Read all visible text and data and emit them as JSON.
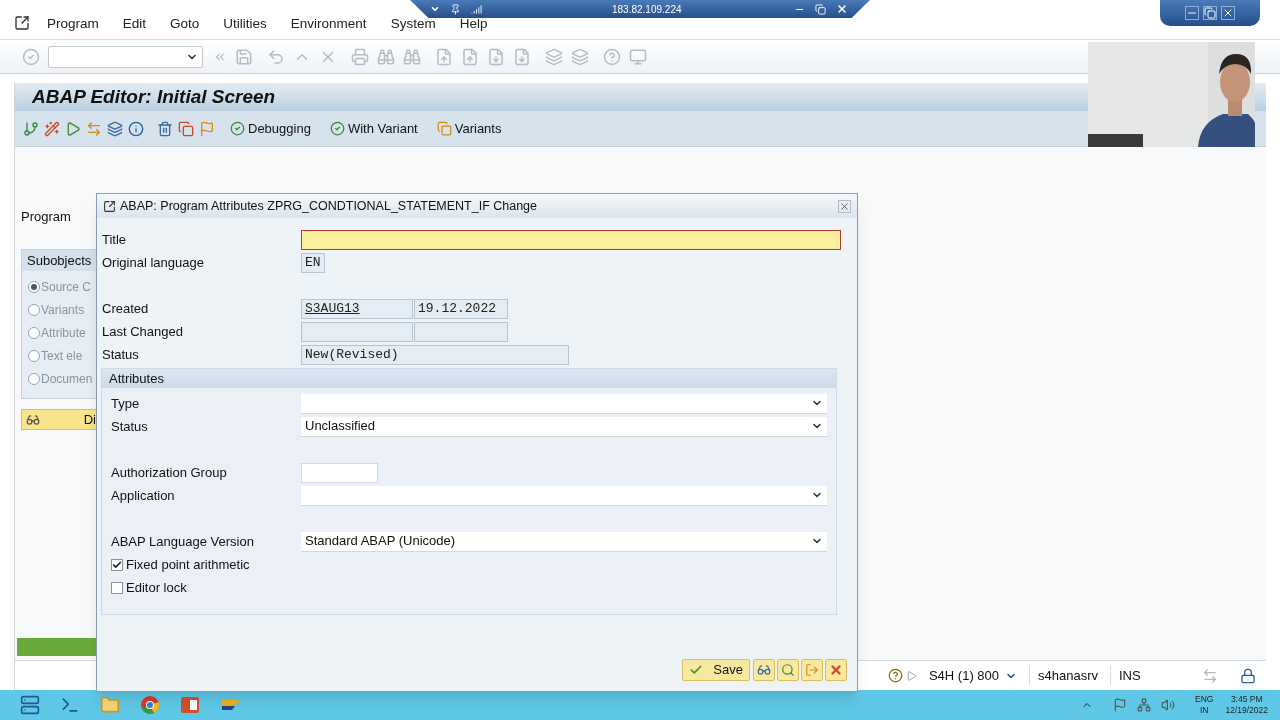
{
  "remote_bar": {
    "address": "183.82.109.224"
  },
  "menu_bar": {
    "items": [
      "Program",
      "Edit",
      "Goto",
      "Utilities",
      "Environment",
      "System",
      "Help"
    ]
  },
  "screen_title": "ABAP Editor: Initial Screen",
  "app_toolbar": {
    "buttons": [
      {
        "label": "Debugging",
        "kind": "debug"
      },
      {
        "label": "With Variant",
        "kind": "debug"
      },
      {
        "label": "Variants",
        "kind": "variants"
      }
    ]
  },
  "background_form": {
    "program_label": "Program",
    "subobjects": {
      "title": "Subobjects",
      "options": [
        {
          "label": "Source C",
          "selected": true
        },
        {
          "label": "Variants",
          "selected": false
        },
        {
          "label": "Attribute",
          "selected": false
        },
        {
          "label": "Text ele",
          "selected": false
        },
        {
          "label": "Documen",
          "selected": false
        }
      ]
    },
    "display_button": "Di"
  },
  "dialog": {
    "title": "ABAP: Program Attributes ZPRG_CONDTIONAL_STATEMENT_IF Change",
    "title_field": {
      "label": "Title"
    },
    "original_language": {
      "label": "Original language",
      "value": "EN"
    },
    "created": {
      "label": "Created",
      "user": "S3AUG13",
      "date": "19.12.2022"
    },
    "last_changed": {
      "label": "Last Changed"
    },
    "status": {
      "label": "Status",
      "value": "New(Revised)"
    },
    "attributes": {
      "heading": "Attributes",
      "type": {
        "label": "Type"
      },
      "status": {
        "label": "Status",
        "value": "Unclassified"
      },
      "authorization_group": {
        "label": "Authorization Group"
      },
      "application": {
        "label": "Application"
      },
      "language_version": {
        "label": "ABAP Language Version",
        "value": "Standard ABAP (Unicode)"
      },
      "options": [
        {
          "label": "Fixed point arithmetic",
          "checked": true
        },
        {
          "label": "Editor lock",
          "checked": false
        }
      ]
    },
    "save_button": "Save"
  },
  "status_bar": {
    "system": "S4H (1) 800",
    "server": "s4hanasrv",
    "mode": "INS"
  },
  "taskbar": {
    "language": "ENG",
    "region": "IN",
    "time": "3:45 PM",
    "date": "12/19/2022"
  }
}
